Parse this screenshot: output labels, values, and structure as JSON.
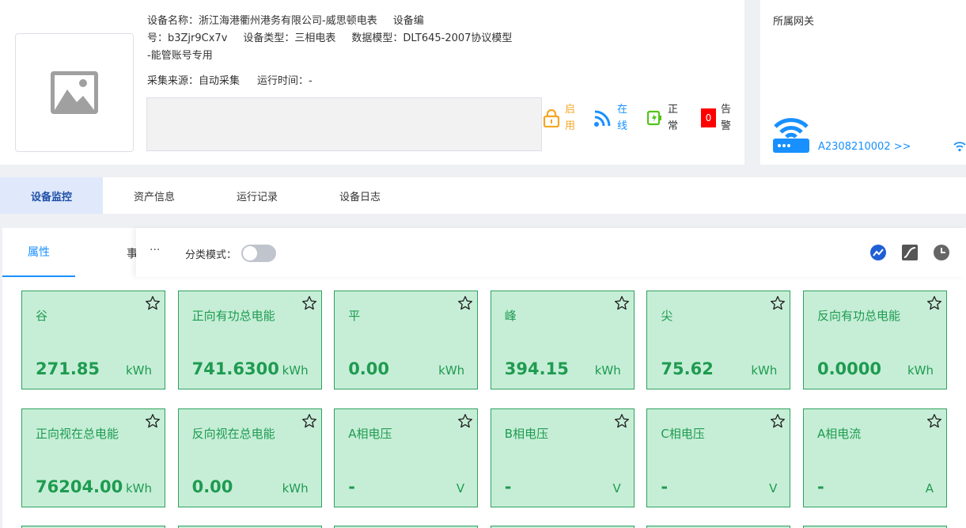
{
  "device": {
    "name_line": "设备名称：浙江海港衢州港务有限公司-威思顿电表",
    "code_label": "设备编",
    "code_line": "号：b3Zjr9Cx7v",
    "type_line": "设备类型：三相电表",
    "model_line": "数据模型：DLT645-2007协议模型",
    "model_cont": "-能管账号专用",
    "source_line": "采集来源：自动采集",
    "runtime_line": "运行时间：-"
  },
  "status": {
    "enable": "启用",
    "online": "在线",
    "normal": "正常",
    "alarm": "告警",
    "alarm_count": "0"
  },
  "gateway": {
    "title": "所属网关",
    "link": "A2308210002  >>"
  },
  "tabs": [
    "设备监控",
    "资产信息",
    "运行记录",
    "设备日志"
  ],
  "subtabs": {
    "property": "属性",
    "event": "事",
    "more": "···"
  },
  "toolbar": {
    "mode_label": "分类模式："
  },
  "cards": [
    {
      "name": "谷",
      "value": "271.85",
      "unit": "kWh"
    },
    {
      "name": "正向有功总电能",
      "value": "741.6300",
      "unit": "kWh"
    },
    {
      "name": "平",
      "value": "0.00",
      "unit": "kWh"
    },
    {
      "name": "峰",
      "value": "394.15",
      "unit": "kWh"
    },
    {
      "name": "尖",
      "value": "75.62",
      "unit": "kWh"
    },
    {
      "name": "反向有功总电能",
      "value": "0.0000",
      "unit": "kWh"
    },
    {
      "name": "正向视在总电能",
      "value": "76204.00",
      "unit": "kWh"
    },
    {
      "name": "反向视在总电能",
      "value": "0.00",
      "unit": "kWh"
    },
    {
      "name": "A相电压",
      "value": "-",
      "unit": "V"
    },
    {
      "name": "B相电压",
      "value": "-",
      "unit": "V"
    },
    {
      "name": "C相电压",
      "value": "-",
      "unit": "V"
    },
    {
      "name": "A相电流",
      "value": "-",
      "unit": "A"
    }
  ],
  "colors": {
    "accent": "#1890ff",
    "card_bg": "#c6eed7",
    "card_text": "#1f9b50",
    "alarm": "#ff0000",
    "warn": "#f5a623"
  }
}
